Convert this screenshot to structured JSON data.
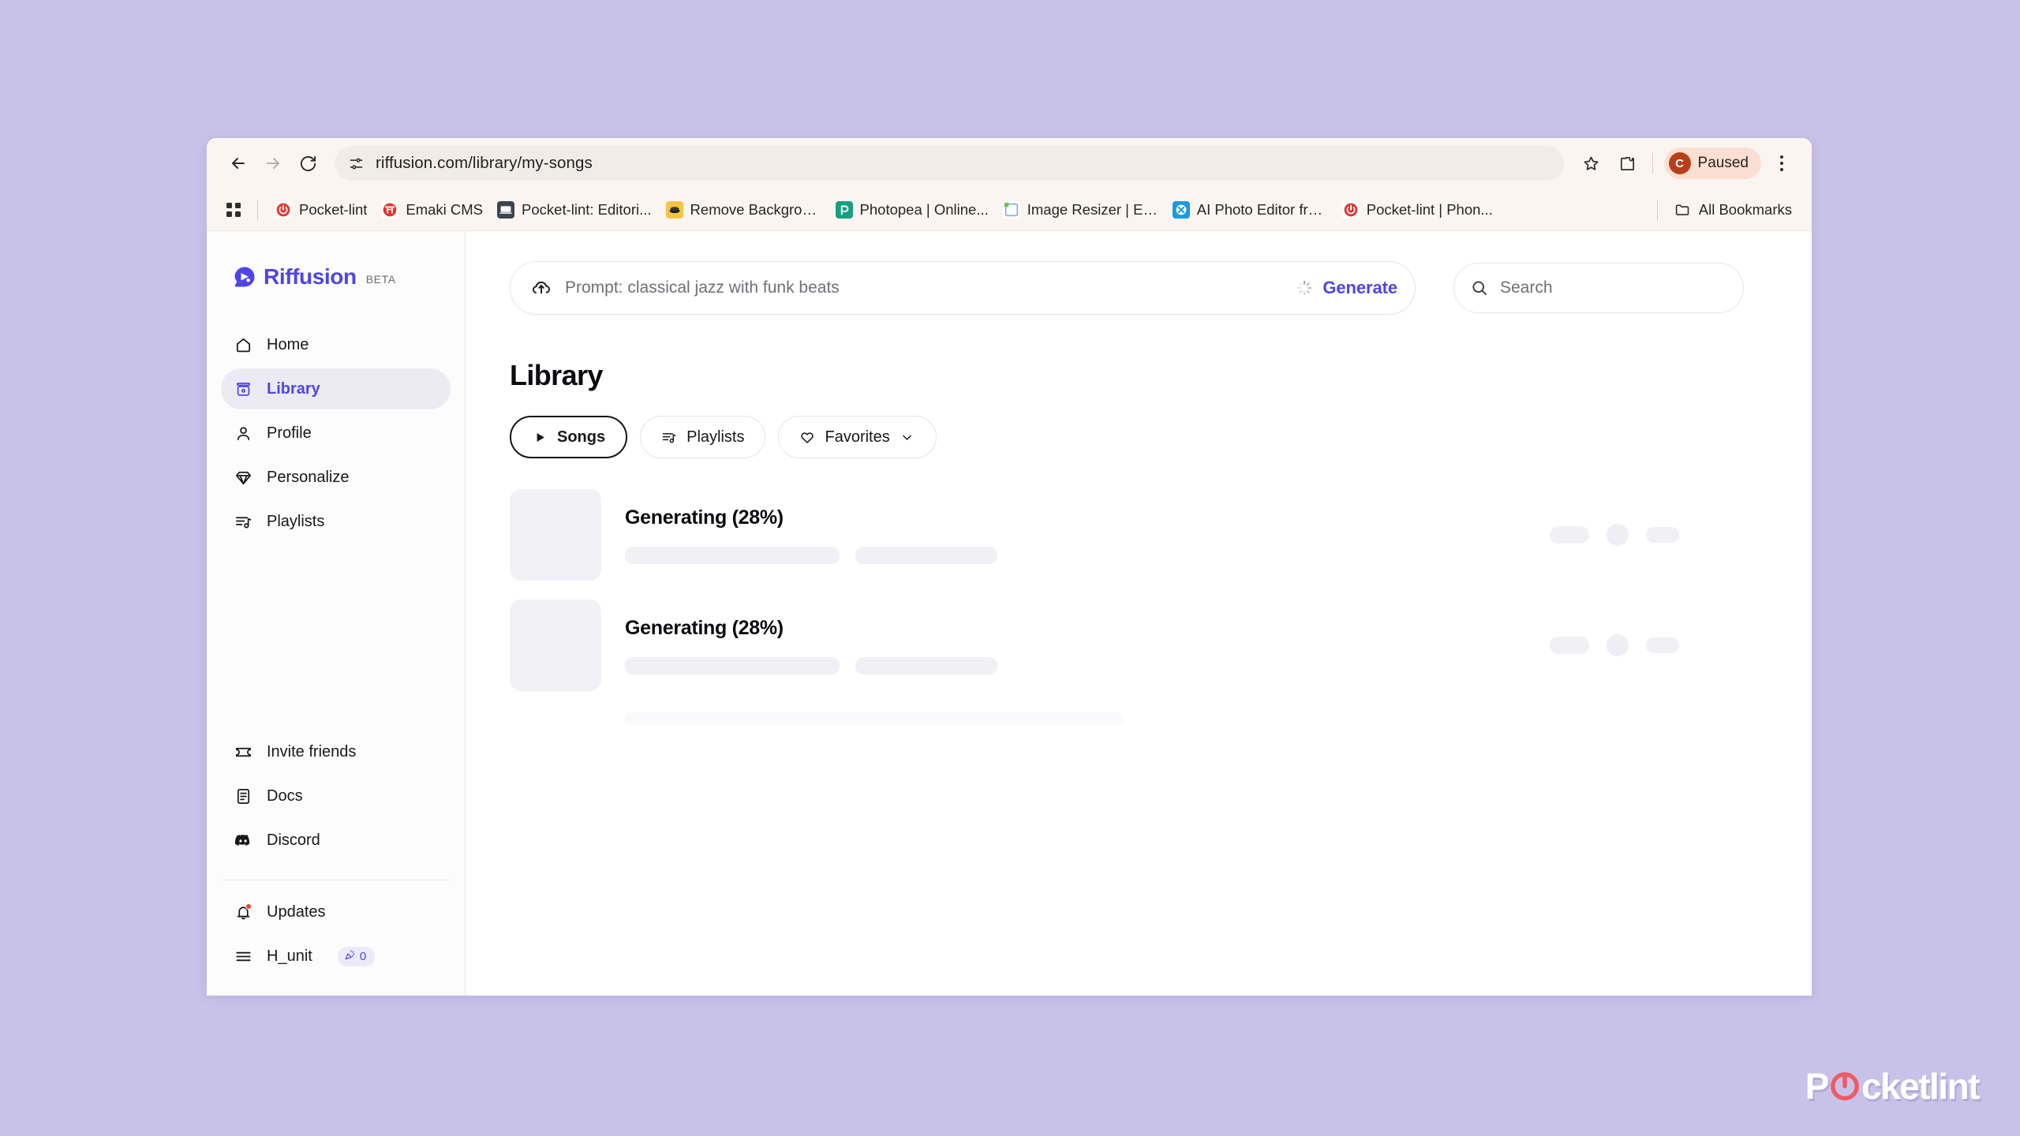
{
  "browser": {
    "url": "riffusion.com/library/my-songs",
    "nav": {
      "back_label": "Back",
      "forward_label": "Forward",
      "reload_label": "Reload"
    },
    "site_settings_icon": "tune-icon",
    "bookmark_star_icon": "star-icon",
    "extensions_icon": "puzzle-icon",
    "profile": {
      "avatar_initial": "C",
      "status_label": "Paused",
      "chip_bg": "#fadfd2",
      "avatar_bg": "#b93f1c"
    },
    "menu_icon": "kebab-menu-icon",
    "bookmarks": {
      "apps_icon": "apps-grid-icon",
      "items": [
        {
          "label": "Pocket-lint",
          "favicon": "pocketlint-power-icon"
        },
        {
          "label": "Emaki CMS",
          "favicon": "emaki-torii-icon"
        },
        {
          "label": "Pocket-lint: Editori...",
          "favicon": "pocketlint-editorial-icon"
        },
        {
          "label": "Remove Backgrou...",
          "favicon": "remove-bg-icon"
        },
        {
          "label": "Photopea | Online...",
          "favicon": "photopea-icon"
        },
        {
          "label": "Image Resizer | Ea...",
          "favicon": "image-resizer-icon"
        },
        {
          "label": "AI Photo Editor fre...",
          "favicon": "ai-photo-editor-icon"
        },
        {
          "label": "Pocket-lint | Phon...",
          "favicon": "pocketlint-power-icon"
        }
      ],
      "all_bookmarks_label": "All Bookmarks",
      "all_bookmarks_icon": "folder-icon"
    }
  },
  "app": {
    "brand": {
      "name": "Riffusion",
      "tag": "BETA",
      "logo_icon": "riffusion-logo-icon",
      "color": "#4f46e5"
    },
    "sidebar": {
      "primary": [
        {
          "label": "Home",
          "icon": "home-icon",
          "active": false
        },
        {
          "label": "Library",
          "icon": "library-icon",
          "active": true
        },
        {
          "label": "Profile",
          "icon": "person-icon",
          "active": false
        },
        {
          "label": "Personalize",
          "icon": "diamond-icon",
          "active": false
        },
        {
          "label": "Playlists",
          "icon": "playlist-icon",
          "active": false
        }
      ],
      "secondary": [
        {
          "label": "Invite friends",
          "icon": "ticket-icon"
        },
        {
          "label": "Docs",
          "icon": "document-icon"
        },
        {
          "label": "Discord",
          "icon": "discord-icon"
        }
      ],
      "footer": [
        {
          "label": "Updates",
          "icon": "bell-icon",
          "has_dot": true
        },
        {
          "label": "H_unit",
          "icon": "hamburger-icon",
          "badge_icon": "party-popper-icon",
          "badge_count": "0"
        }
      ]
    },
    "prompt": {
      "upload_icon": "upload-cloud-icon",
      "placeholder": "Prompt: classical jazz with funk beats",
      "spinner_icon": "loading-spinner-icon",
      "generate_label": "Generate"
    },
    "search": {
      "icon": "search-icon",
      "placeholder": "Search"
    },
    "main": {
      "title": "Library",
      "filters": [
        {
          "label": "Songs",
          "icon": "play-icon",
          "active": true,
          "chevron": false
        },
        {
          "label": "Playlists",
          "icon": "playlist-icon",
          "active": false,
          "chevron": false
        },
        {
          "label": "Favorites",
          "icon": "heart-icon",
          "active": false,
          "chevron": true,
          "chevron_icon": "chevron-down-icon"
        }
      ],
      "songs": [
        {
          "status": "Generating (28%)"
        },
        {
          "status": "Generating (28%)"
        }
      ]
    }
  },
  "watermark": {
    "prefix": "P",
    "suffix": "cketlint",
    "icon": "power-button-icon"
  }
}
